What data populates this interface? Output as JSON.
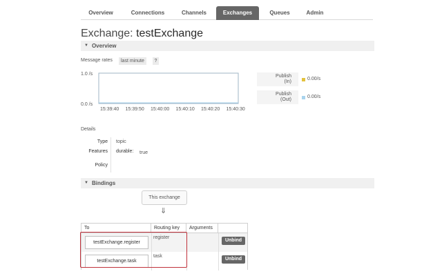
{
  "tabs": [
    {
      "label": "Overview"
    },
    {
      "label": "Connections"
    },
    {
      "label": "Channels"
    },
    {
      "label": "Exchanges",
      "active": true
    },
    {
      "label": "Queues"
    },
    {
      "label": "Admin"
    }
  ],
  "title": {
    "prefix": "Exchange:",
    "name": "testExchange"
  },
  "overview": {
    "header": "Overview",
    "rates_label": "Message rates",
    "range": "last minute",
    "help": "?"
  },
  "chart_data": {
    "type": "line",
    "x": [
      "15:39:40",
      "15:39:50",
      "15:40:00",
      "15:40:10",
      "15:40:20",
      "15:40:30"
    ],
    "yticks": [
      "1.0 /s",
      "0.0 /s"
    ],
    "ylim": [
      0,
      1
    ],
    "series": [
      {
        "name": "Publish (In)",
        "color": "#e3c23e",
        "values": [
          0,
          0,
          0,
          0,
          0,
          0
        ]
      },
      {
        "name": "Publish (Out)",
        "color": "#a9d4ee",
        "values": [
          0,
          0,
          0,
          0,
          0,
          0
        ]
      }
    ],
    "legend": [
      {
        "label_line1": "Publish",
        "label_line2": "(In)",
        "value": "0.00/s",
        "color": "#e3c23e"
      },
      {
        "label_line1": "Publish",
        "label_line2": "(Out)",
        "value": "0.00/s",
        "color": "#a9d4ee"
      }
    ]
  },
  "details": {
    "label": "Details",
    "type_key": "Type",
    "type_val": "topic",
    "features_key": "Features",
    "durable_key": "durable:",
    "durable_val": "true",
    "policy_key": "Policy"
  },
  "bindings": {
    "header": "Bindings",
    "this_exchange": "This exchange",
    "arrow": "⇓",
    "columns": [
      "To",
      "Routing key",
      "Arguments"
    ],
    "rows": [
      {
        "to": "testExchange.register",
        "routing_key": "register",
        "action": "Unbind"
      },
      {
        "to": "testExchange.task",
        "routing_key": "task",
        "action": "Unbind"
      }
    ]
  }
}
